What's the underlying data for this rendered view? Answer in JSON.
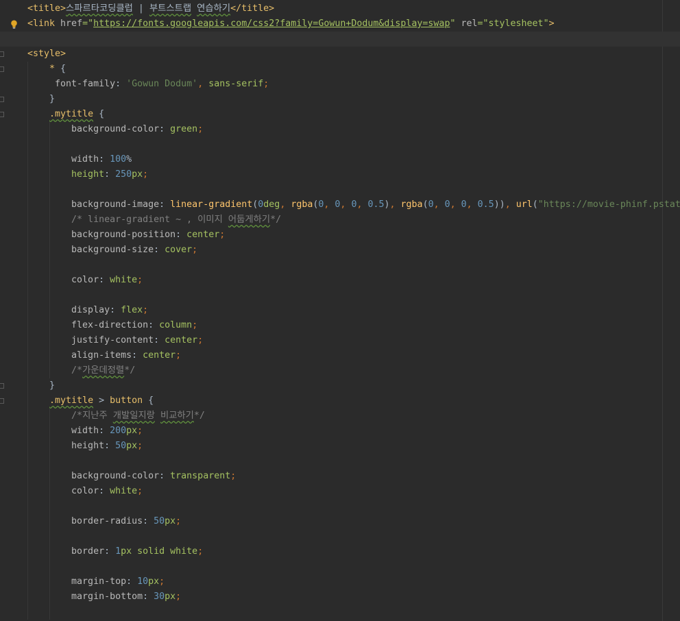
{
  "editor": {
    "lines": [
      {
        "fold": false,
        "bulb": false,
        "current": false,
        "segments": [
          {
            "t": "<title>",
            "c": "tag"
          },
          {
            "t": "스파르타코딩클럽",
            "c": "plain wavy"
          },
          {
            "t": " | ",
            "c": "plain"
          },
          {
            "t": "부트스트랩",
            "c": "plain wavy"
          },
          {
            "t": " ",
            "c": "plain"
          },
          {
            "t": "연습하기",
            "c": "plain wavy"
          },
          {
            "t": "</title>",
            "c": "tag"
          }
        ]
      },
      {
        "fold": false,
        "bulb": true,
        "current": false,
        "segments": [
          {
            "t": "<link ",
            "c": "tag"
          },
          {
            "t": "href",
            "c": "attr"
          },
          {
            "t": "=\"",
            "c": "str"
          },
          {
            "t": "https://fonts.googleapis.com/css2?family=Gowun+Dodum&display=swap",
            "c": "url"
          },
          {
            "t": "\" ",
            "c": "str"
          },
          {
            "t": "rel",
            "c": "attr"
          },
          {
            "t": "=\"stylesheet\"",
            "c": "str"
          },
          {
            "t": ">",
            "c": "tag"
          }
        ]
      },
      {
        "fold": false,
        "bulb": false,
        "current": true,
        "segments": []
      },
      {
        "fold": true,
        "bulb": false,
        "current": false,
        "segments": [
          {
            "t": "<style>",
            "c": "tag"
          }
        ]
      },
      {
        "fold": true,
        "bulb": false,
        "current": false,
        "segments": [
          {
            "t": "    ",
            "c": "plain"
          },
          {
            "t": "* ",
            "c": "sel"
          },
          {
            "t": "{",
            "c": "plain"
          }
        ]
      },
      {
        "fold": false,
        "bulb": false,
        "current": false,
        "segments": [
          {
            "t": "     font-family",
            "c": "prop"
          },
          {
            "t": ": ",
            "c": "plain"
          },
          {
            "t": "'Gowun Dodum'",
            "c": "strq"
          },
          {
            "t": ", ",
            "c": "punct"
          },
          {
            "t": "sans-serif",
            "c": "val"
          },
          {
            "t": ";",
            "c": "punct"
          }
        ]
      },
      {
        "fold": true,
        "bulb": false,
        "current": false,
        "segments": [
          {
            "t": "    }",
            "c": "plain"
          }
        ]
      },
      {
        "fold": true,
        "bulb": false,
        "current": false,
        "segments": [
          {
            "t": "    ",
            "c": "plain"
          },
          {
            "t": ".mytitle",
            "c": "sel wavy"
          },
          {
            "t": " {",
            "c": "plain"
          }
        ]
      },
      {
        "fold": false,
        "bulb": false,
        "current": false,
        "segments": [
          {
            "t": "        background-color",
            "c": "prop"
          },
          {
            "t": ": ",
            "c": "plain"
          },
          {
            "t": "green",
            "c": "val"
          },
          {
            "t": ";",
            "c": "punct"
          }
        ]
      },
      {
        "fold": false,
        "bulb": false,
        "current": false,
        "segments": []
      },
      {
        "fold": false,
        "bulb": false,
        "current": false,
        "segments": [
          {
            "t": "        width",
            "c": "prop"
          },
          {
            "t": ": ",
            "c": "plain"
          },
          {
            "t": "100",
            "c": "num"
          },
          {
            "t": "%",
            "c": "plain"
          }
        ]
      },
      {
        "fold": false,
        "bulb": false,
        "current": false,
        "segments": [
          {
            "t": "        height",
            "c": "val"
          },
          {
            "t": ": ",
            "c": "plain"
          },
          {
            "t": "250",
            "c": "num"
          },
          {
            "t": "px",
            "c": "unit"
          },
          {
            "t": ";",
            "c": "punct"
          }
        ]
      },
      {
        "fold": false,
        "bulb": false,
        "current": false,
        "segments": []
      },
      {
        "fold": false,
        "bulb": false,
        "current": false,
        "segments": [
          {
            "t": "        background-image",
            "c": "prop"
          },
          {
            "t": ": ",
            "c": "plain"
          },
          {
            "t": "linear-gradient",
            "c": "fn"
          },
          {
            "t": "(",
            "c": "plain"
          },
          {
            "t": "0",
            "c": "num"
          },
          {
            "t": "deg",
            "c": "unit"
          },
          {
            "t": ", ",
            "c": "punct"
          },
          {
            "t": "rgba",
            "c": "fn"
          },
          {
            "t": "(",
            "c": "plain"
          },
          {
            "t": "0",
            "c": "num"
          },
          {
            "t": ", ",
            "c": "punct"
          },
          {
            "t": "0",
            "c": "num"
          },
          {
            "t": ", ",
            "c": "punct"
          },
          {
            "t": "0",
            "c": "num"
          },
          {
            "t": ", ",
            "c": "punct"
          },
          {
            "t": "0.5",
            "c": "num"
          },
          {
            "t": ")",
            "c": "plain"
          },
          {
            "t": ", ",
            "c": "punct"
          },
          {
            "t": "rgba",
            "c": "fn"
          },
          {
            "t": "(",
            "c": "plain"
          },
          {
            "t": "0",
            "c": "num"
          },
          {
            "t": ", ",
            "c": "punct"
          },
          {
            "t": "0",
            "c": "num"
          },
          {
            "t": ", ",
            "c": "punct"
          },
          {
            "t": "0",
            "c": "num"
          },
          {
            "t": ", ",
            "c": "punct"
          },
          {
            "t": "0.5",
            "c": "num"
          },
          {
            "t": "))",
            "c": "plain"
          },
          {
            "t": ", ",
            "c": "punct"
          },
          {
            "t": "url",
            "c": "fn"
          },
          {
            "t": "(",
            "c": "plain"
          },
          {
            "t": "\"https://movie-phinf.pstat",
            "c": "strq"
          }
        ]
      },
      {
        "fold": false,
        "bulb": false,
        "current": false,
        "segments": [
          {
            "t": "        /* linear-gradient ~ , ",
            "c": "comment"
          },
          {
            "t": "이미지",
            "c": "comment"
          },
          {
            "t": " ",
            "c": "comment"
          },
          {
            "t": "어둡게하기",
            "c": "comment wavy"
          },
          {
            "t": "*/",
            "c": "comment"
          }
        ]
      },
      {
        "fold": false,
        "bulb": false,
        "current": false,
        "segments": [
          {
            "t": "        background-position",
            "c": "prop"
          },
          {
            "t": ": ",
            "c": "plain"
          },
          {
            "t": "center",
            "c": "val"
          },
          {
            "t": ";",
            "c": "punct"
          }
        ]
      },
      {
        "fold": false,
        "bulb": false,
        "current": false,
        "segments": [
          {
            "t": "        background-size",
            "c": "prop"
          },
          {
            "t": ": ",
            "c": "plain"
          },
          {
            "t": "cover",
            "c": "val"
          },
          {
            "t": ";",
            "c": "punct"
          }
        ]
      },
      {
        "fold": false,
        "bulb": false,
        "current": false,
        "segments": []
      },
      {
        "fold": false,
        "bulb": false,
        "current": false,
        "segments": [
          {
            "t": "        color",
            "c": "prop"
          },
          {
            "t": ": ",
            "c": "plain"
          },
          {
            "t": "white",
            "c": "val"
          },
          {
            "t": ";",
            "c": "punct"
          }
        ]
      },
      {
        "fold": false,
        "bulb": false,
        "current": false,
        "segments": []
      },
      {
        "fold": false,
        "bulb": false,
        "current": false,
        "segments": [
          {
            "t": "        display",
            "c": "prop"
          },
          {
            "t": ": ",
            "c": "plain"
          },
          {
            "t": "flex",
            "c": "val"
          },
          {
            "t": ";",
            "c": "punct"
          }
        ]
      },
      {
        "fold": false,
        "bulb": false,
        "current": false,
        "segments": [
          {
            "t": "        flex-direction",
            "c": "prop"
          },
          {
            "t": ": ",
            "c": "plain"
          },
          {
            "t": "column",
            "c": "val"
          },
          {
            "t": ";",
            "c": "punct"
          }
        ]
      },
      {
        "fold": false,
        "bulb": false,
        "current": false,
        "segments": [
          {
            "t": "        justify-content",
            "c": "prop"
          },
          {
            "t": ": ",
            "c": "plain"
          },
          {
            "t": "center",
            "c": "val"
          },
          {
            "t": ";",
            "c": "punct"
          }
        ]
      },
      {
        "fold": false,
        "bulb": false,
        "current": false,
        "segments": [
          {
            "t": "        align-items",
            "c": "prop"
          },
          {
            "t": ": ",
            "c": "plain"
          },
          {
            "t": "center",
            "c": "val"
          },
          {
            "t": ";",
            "c": "punct"
          }
        ]
      },
      {
        "fold": false,
        "bulb": false,
        "current": false,
        "segments": [
          {
            "t": "        /*",
            "c": "comment"
          },
          {
            "t": "가운데정렬",
            "c": "comment wavy"
          },
          {
            "t": "*/",
            "c": "comment"
          }
        ]
      },
      {
        "fold": true,
        "bulb": false,
        "current": false,
        "segments": [
          {
            "t": "    }",
            "c": "plain"
          }
        ]
      },
      {
        "fold": true,
        "bulb": false,
        "current": false,
        "segments": [
          {
            "t": "    ",
            "c": "plain"
          },
          {
            "t": ".mytitle",
            "c": "sel wavy"
          },
          {
            "t": " > ",
            "c": "plain"
          },
          {
            "t": "button",
            "c": "sel"
          },
          {
            "t": " {",
            "c": "plain"
          }
        ]
      },
      {
        "fold": false,
        "bulb": false,
        "current": false,
        "segments": [
          {
            "t": "        /*",
            "c": "comment"
          },
          {
            "t": "지난주",
            "c": "comment"
          },
          {
            "t": " ",
            "c": "comment"
          },
          {
            "t": "개발일지랑",
            "c": "comment wavy"
          },
          {
            "t": " ",
            "c": "comment"
          },
          {
            "t": "비교하기",
            "c": "comment wavy"
          },
          {
            "t": "*/",
            "c": "comment"
          }
        ]
      },
      {
        "fold": false,
        "bulb": false,
        "current": false,
        "segments": [
          {
            "t": "        width",
            "c": "prop"
          },
          {
            "t": ": ",
            "c": "plain"
          },
          {
            "t": "200",
            "c": "num"
          },
          {
            "t": "px",
            "c": "unit"
          },
          {
            "t": ";",
            "c": "punct"
          }
        ]
      },
      {
        "fold": false,
        "bulb": false,
        "current": false,
        "segments": [
          {
            "t": "        height",
            "c": "prop"
          },
          {
            "t": ": ",
            "c": "plain"
          },
          {
            "t": "50",
            "c": "num"
          },
          {
            "t": "px",
            "c": "unit"
          },
          {
            "t": ";",
            "c": "punct"
          }
        ]
      },
      {
        "fold": false,
        "bulb": false,
        "current": false,
        "segments": []
      },
      {
        "fold": false,
        "bulb": false,
        "current": false,
        "segments": [
          {
            "t": "        background-color",
            "c": "prop"
          },
          {
            "t": ": ",
            "c": "plain"
          },
          {
            "t": "transparent",
            "c": "val"
          },
          {
            "t": ";",
            "c": "punct"
          }
        ]
      },
      {
        "fold": false,
        "bulb": false,
        "current": false,
        "segments": [
          {
            "t": "        color",
            "c": "prop"
          },
          {
            "t": ": ",
            "c": "plain"
          },
          {
            "t": "white",
            "c": "val"
          },
          {
            "t": ";",
            "c": "punct"
          }
        ]
      },
      {
        "fold": false,
        "bulb": false,
        "current": false,
        "segments": []
      },
      {
        "fold": false,
        "bulb": false,
        "current": false,
        "segments": [
          {
            "t": "        border-radius",
            "c": "prop"
          },
          {
            "t": ": ",
            "c": "plain"
          },
          {
            "t": "50",
            "c": "num"
          },
          {
            "t": "px",
            "c": "unit"
          },
          {
            "t": ";",
            "c": "punct"
          }
        ]
      },
      {
        "fold": false,
        "bulb": false,
        "current": false,
        "segments": []
      },
      {
        "fold": false,
        "bulb": false,
        "current": false,
        "segments": [
          {
            "t": "        border",
            "c": "prop"
          },
          {
            "t": ": ",
            "c": "plain"
          },
          {
            "t": "1",
            "c": "num"
          },
          {
            "t": "px solid white",
            "c": "val"
          },
          {
            "t": ";",
            "c": "punct"
          }
        ]
      },
      {
        "fold": false,
        "bulb": false,
        "current": false,
        "segments": []
      },
      {
        "fold": false,
        "bulb": false,
        "current": false,
        "segments": [
          {
            "t": "        margin-top",
            "c": "prop"
          },
          {
            "t": ": ",
            "c": "plain"
          },
          {
            "t": "10",
            "c": "num"
          },
          {
            "t": "px",
            "c": "unit"
          },
          {
            "t": ";",
            "c": "punct"
          }
        ]
      },
      {
        "fold": false,
        "bulb": false,
        "current": false,
        "segments": [
          {
            "t": "        margin-bottom",
            "c": "prop"
          },
          {
            "t": ": ",
            "c": "plain"
          },
          {
            "t": "30",
            "c": "num"
          },
          {
            "t": "px",
            "c": "unit"
          },
          {
            "t": ";",
            "c": "punct"
          }
        ]
      },
      {
        "fold": false,
        "bulb": false,
        "current": false,
        "segments": []
      }
    ]
  }
}
